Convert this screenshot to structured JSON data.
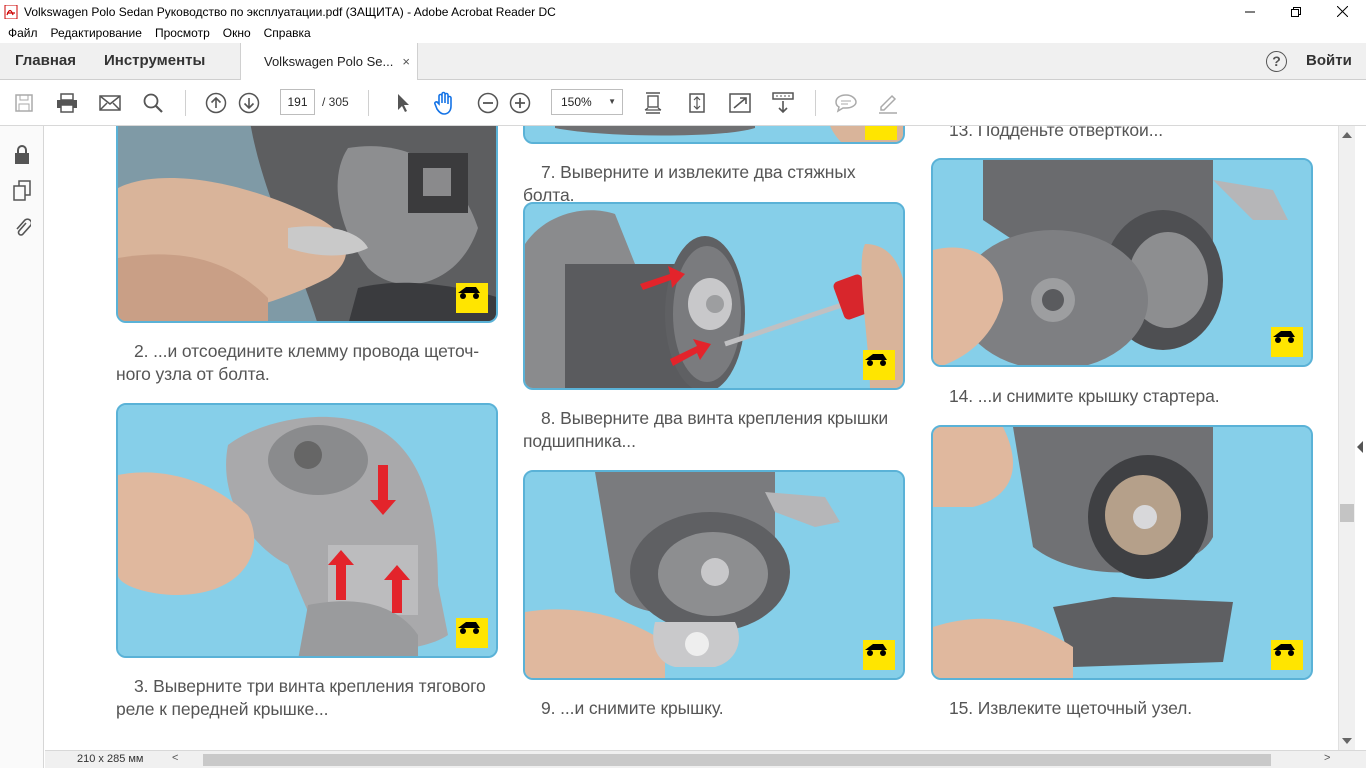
{
  "window": {
    "title": "Volkswagen Polo Sedan Руководство по эксплуатации.pdf (ЗАЩИТА) - Adobe Acrobat Reader DC"
  },
  "menu": [
    "Файл",
    "Редактирование",
    "Просмотр",
    "Окно",
    "Справка"
  ],
  "nav": {
    "home": "Главная",
    "tools": "Инструменты",
    "doc_tab": "Volkswagen Polo Se...",
    "close": "×",
    "help": "?",
    "signin": "Войти"
  },
  "toolbar": {
    "page_current": "191",
    "page_total": "/ 305",
    "zoom": "150%"
  },
  "captions": {
    "c2": "2. ...и отсоедините клемму провода щеточ-ного узла от болта.",
    "c3": "3. Выверните три винта крепления тягового реле к передней крышке...",
    "c7": "7. Выверните и извлеките два стяжных болта.",
    "c8": "8. Выверните два винта крепления крышки подшипника...",
    "c9": "9. ...и снимите крышку.",
    "c13": "13. Подденьте отверткой...",
    "c14": "14. ...и снимите крышку стартера.",
    "c15": "15. Извлеките щеточный узел."
  },
  "status": {
    "page_size": "210 x 285 мм"
  },
  "colors": {
    "photo_border": "#5ab2d7",
    "photo_bg": "#86cfe9",
    "badge": "#ffe500",
    "arrow": "#e3242b"
  }
}
